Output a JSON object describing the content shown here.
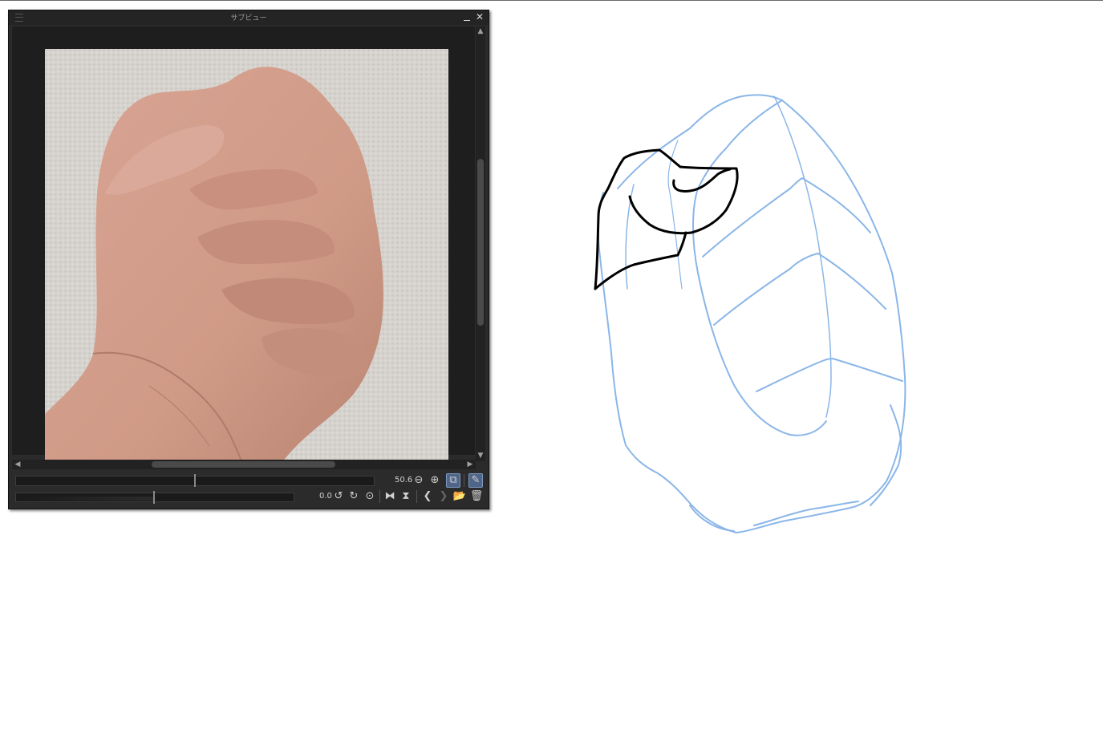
{
  "subview": {
    "title": "サブビュー",
    "zoom_value": "50.6",
    "rotation_value": "0.0",
    "icons": {
      "menu": "hamburger-icon",
      "minimize": "minimize-icon",
      "close": "close-icon",
      "zoom_out": "zoom-out-icon",
      "zoom_in": "zoom-in-icon",
      "fit": "fit-to-window-icon",
      "eyedropper": "eyedropper-icon",
      "rotate_left": "rotate-left-icon",
      "rotate_right": "rotate-right-icon",
      "reset_rotation": "reset-rotation-icon",
      "flip_h": "flip-horizontal-icon",
      "flip_v": "flip-vertical-icon",
      "prev": "previous-image-icon",
      "next": "next-image-icon",
      "import": "import-image-icon",
      "delete": "delete-image-icon"
    },
    "glyphs": {
      "close": "✕",
      "zoom_out": "⊖",
      "zoom_in": "⊕",
      "fit": "⧉",
      "eyedropper": "✎",
      "rotate_left": "↺",
      "rotate_right": "↻",
      "reset_rotation": "⊙",
      "flip_h": "⧓",
      "flip_v": "⧗",
      "prev": "❮",
      "next": "❯",
      "import": "📂",
      "delete": "🗑",
      "up": "▲",
      "down": "▼",
      "left": "◀",
      "right": "▶"
    },
    "colors": {
      "panel_bg": "#2b2b2b",
      "active_button": "#4f6688"
    }
  },
  "canvas": {
    "sketch_color": "#8ab6e8",
    "ink_color": "#000000"
  }
}
